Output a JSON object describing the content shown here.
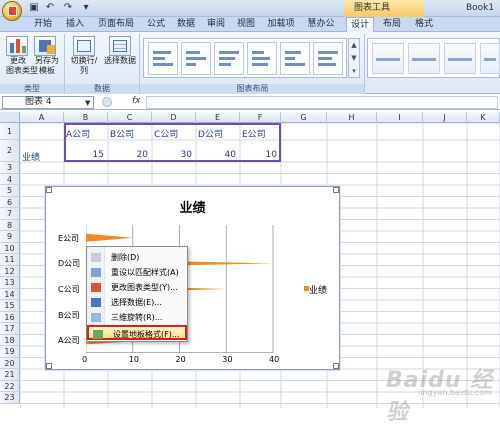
{
  "app": {
    "chart_tools_label": "图表工具",
    "book_title": "Book1"
  },
  "tabs": [
    {
      "label": "开始"
    },
    {
      "label": "插入"
    },
    {
      "label": "页面布局"
    },
    {
      "label": "公式"
    },
    {
      "label": "数据"
    },
    {
      "label": "审阅"
    },
    {
      "label": "视图"
    },
    {
      "label": "加载项"
    },
    {
      "label": "慧办公"
    },
    {
      "label": "设计"
    },
    {
      "label": "布局"
    },
    {
      "label": "格式"
    }
  ],
  "ribbon": {
    "change_chart_type": "更改\n图表类型",
    "save_template": "另存为\n模板",
    "group_type": "类型",
    "switch_row_col": "切换行/列",
    "select_data": "选择数据",
    "group_data": "数据",
    "group_layout": "图表布局"
  },
  "formula_bar": {
    "name_box": "图表 4",
    "fx": "fx",
    "formula": ""
  },
  "grid": {
    "columns": [
      "A",
      "B",
      "C",
      "D",
      "E",
      "F",
      "G",
      "H",
      "I",
      "J",
      "K"
    ],
    "rows": [
      "1",
      "2",
      "3",
      "4",
      "5",
      "6",
      "7",
      "8",
      "9",
      "10",
      "11",
      "12",
      "13",
      "14",
      "15",
      "16",
      "17",
      "18",
      "19",
      "20",
      "21",
      "22",
      "23"
    ],
    "header_row": [
      "A公司",
      "B公司",
      "C公司",
      "D公司",
      "E公司"
    ],
    "row2_label": "业绩",
    "row2_values": [
      "15",
      "20",
      "30",
      "40",
      "10"
    ]
  },
  "chart_data": {
    "type": "bar",
    "orientation": "horizontal",
    "title": "业绩",
    "categories": [
      "A公司",
      "B公司",
      "C公司",
      "D公司",
      "E公司"
    ],
    "series": [
      {
        "name": "业绩",
        "values": [
          15,
          20,
          30,
          40,
          10
        ]
      }
    ],
    "xlim": [
      0,
      40
    ],
    "xticks": [
      "0",
      "10",
      "20",
      "30",
      "40"
    ],
    "legend": "right",
    "bar_color": "#f08a24"
  },
  "context_menu": {
    "items": [
      {
        "label": "删除(D)",
        "icon": "delete-icon"
      },
      {
        "label": "重设以匹配样式(A)",
        "icon": "reset-style-icon"
      },
      {
        "label": "更改图表类型(Y)...",
        "icon": "chart-type-icon"
      },
      {
        "label": "选择数据(E)...",
        "icon": "select-data-icon"
      },
      {
        "label": "三维旋转(R)...",
        "icon": "rotate-3d-icon"
      },
      {
        "label": "设置地板格式(F)...",
        "icon": "format-floor-icon"
      }
    ]
  },
  "watermark": {
    "brand": "Baidu 经验",
    "sub": "jingyan.baidu.com"
  }
}
